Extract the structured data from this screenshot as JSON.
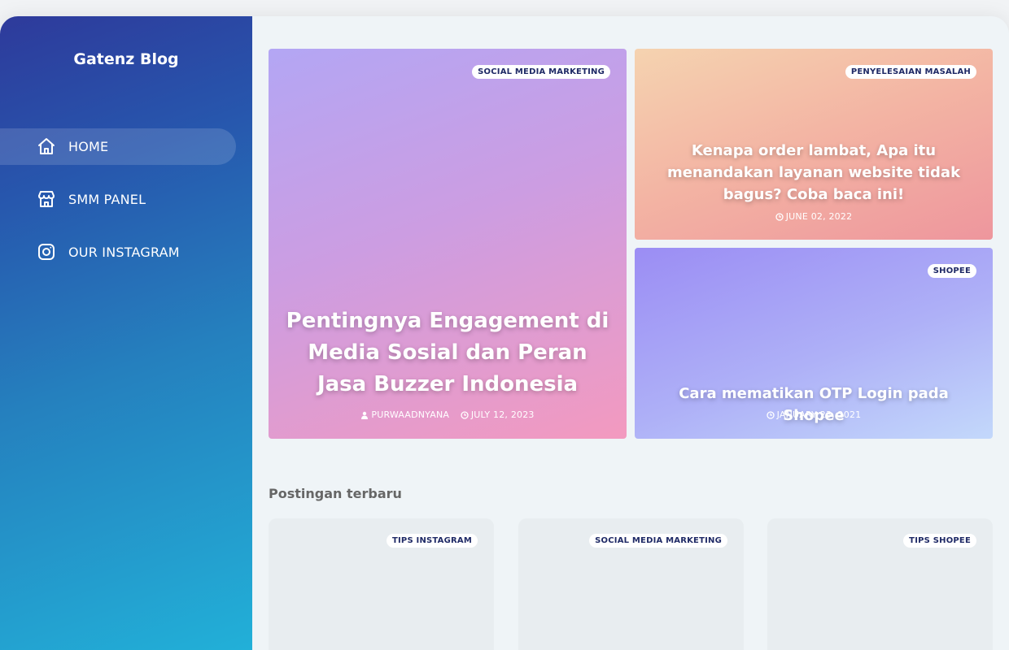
{
  "sidebar": {
    "brand": "Gatenz Blog",
    "items": [
      {
        "label": "HOME",
        "icon": "home-icon"
      },
      {
        "label": "SMM PANEL",
        "icon": "store-icon"
      },
      {
        "label": "OUR INSTAGRAM",
        "icon": "instagram-icon"
      }
    ]
  },
  "featured": [
    {
      "category": "SOCIAL MEDIA MARKETING",
      "title": "Pentingnya Engagement di Media Sosial dan Peran Jasa Buzzer Indonesia",
      "author": "PURWAADNYANA",
      "date": "JULY 12, 2023"
    },
    {
      "category": "PENYELESAIAN MASALAH",
      "title": "Kenapa order lambat, Apa itu menandakan layanan website tidak bagus? Coba baca ini!",
      "date": "JUNE 02, 2022"
    },
    {
      "category": "SHOPEE",
      "title": "Cara mematikan OTP Login pada Shopee",
      "date": "JANUARY 23, 2021"
    }
  ],
  "recent": {
    "heading": "Postingan terbaru",
    "posts": [
      {
        "category": "TIPS INSTAGRAM"
      },
      {
        "category": "SOCIAL MEDIA MARKETING"
      },
      {
        "category": "TIPS SHOPEE"
      }
    ]
  },
  "colors": {
    "sidebar_top": "#2e3a9b",
    "sidebar_bottom": "#22b0d8",
    "badge_text": "#1f2a66",
    "main_bg": "#eff4f7"
  }
}
